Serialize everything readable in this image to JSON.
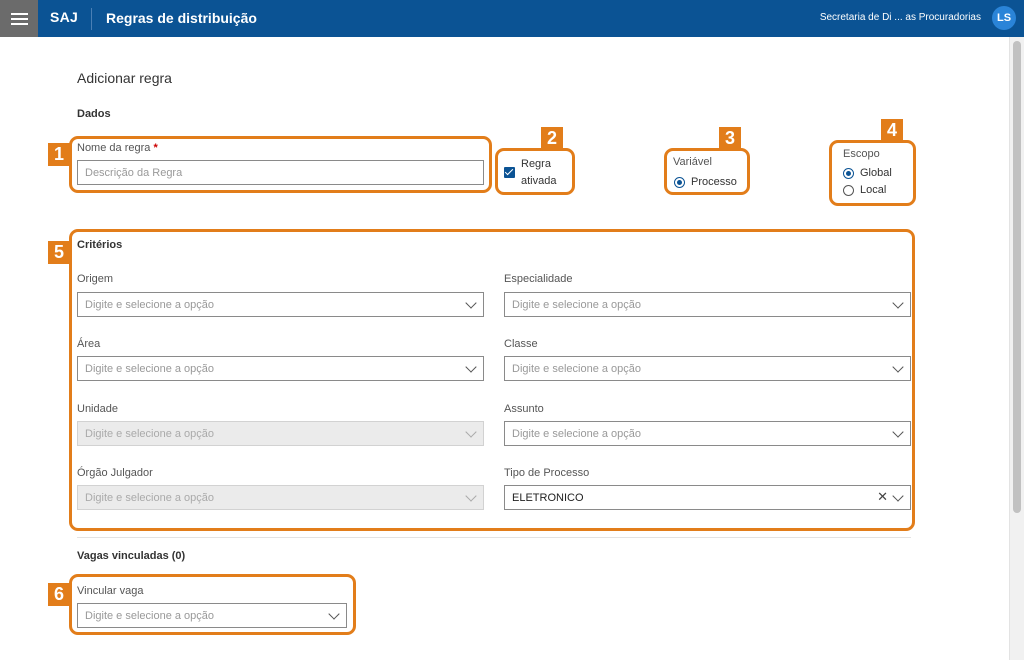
{
  "header": {
    "brand": "SAJ",
    "title": "Regras de distribuição",
    "user_department": "Secretaria de Di ... as Procuradorias",
    "avatar_initials": "LS"
  },
  "page": {
    "title": "Adicionar regra",
    "dados_label": "Dados"
  },
  "dados": {
    "rule_name_label": "Nome da regra",
    "required_mark": "*",
    "rule_name_placeholder": "Descrição da Regra",
    "rule_active_label_line1": "Regra",
    "rule_active_label_line2": "ativada",
    "rule_active_checked": true,
    "variavel_label": "Variável",
    "variavel_option": "Processo",
    "escopo_label": "Escopo",
    "escopo_options": [
      "Global",
      "Local"
    ],
    "escopo_selected": "Global"
  },
  "criterios": {
    "title": "Critérios",
    "placeholder": "Digite e selecione a opção",
    "fields": {
      "origem": "Origem",
      "especialidade": "Especialidade",
      "area": "Área",
      "classe": "Classe",
      "unidade": "Unidade",
      "assunto": "Assunto",
      "orgao_julgador": "Órgão Julgador",
      "tipo_processo": "Tipo de Processo"
    },
    "tipo_processo_value": "ELETRONICO"
  },
  "vagas": {
    "title": "Vagas vinculadas (0)",
    "vincular_label": "Vincular vaga",
    "vincular_placeholder": "Digite e selecione a opção"
  },
  "callouts": [
    "1",
    "2",
    "3",
    "4",
    "5",
    "6"
  ],
  "colors": {
    "header_bg": "#0b5394",
    "callout": "#e27d1a",
    "menu_bg": "#6b6b6b"
  }
}
